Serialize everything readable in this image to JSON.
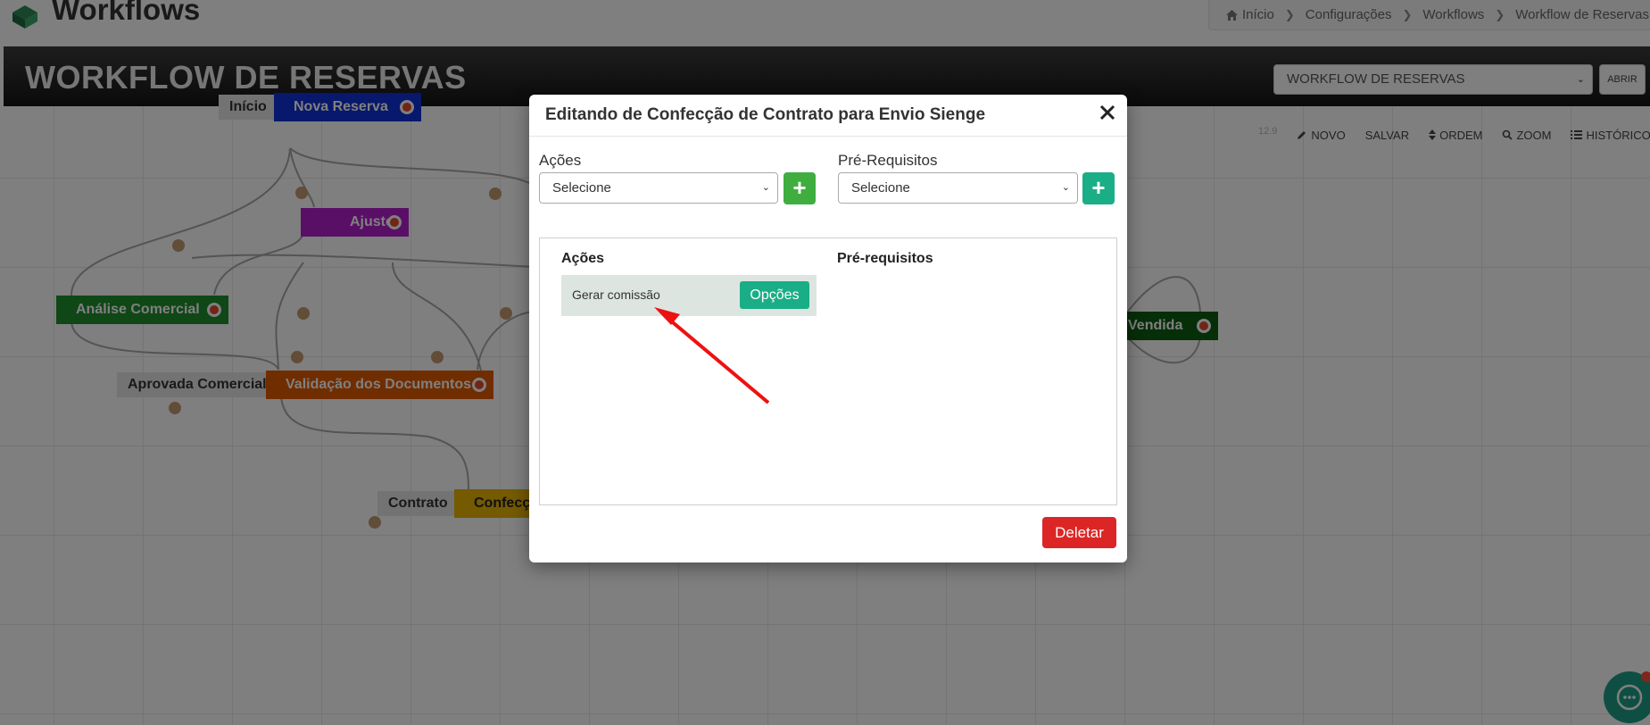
{
  "header": {
    "title": "Workflows",
    "breadcrumb": [
      "Início",
      "Configurações",
      "Workflows",
      "Workflow de Reservas"
    ]
  },
  "banner": {
    "title": "WORKFLOW DE RESERVAS",
    "selected_workflow": "WORKFLOW DE RESERVAS",
    "open_label": "ABRIR"
  },
  "toolbar": {
    "faint_label": "12.9",
    "novo": "NOVO",
    "salvar": "SALVAR",
    "ordem": "ORDEM",
    "zoom": "ZOOM",
    "historico": "HISTÓRICO"
  },
  "workflow": {
    "labels": [
      "Início",
      "Aprovada Comercial",
      "Contrato"
    ],
    "nodes": [
      "Nova Reserva",
      "Ajustes",
      "Análise Comercial",
      "Validação dos Documentos",
      "Confecção de Contrato",
      "Vendida"
    ]
  },
  "colors": {
    "nova_reserva": "#1030d8",
    "ajustes": "#b51fcf",
    "analise_comercial": "#1f8f2f",
    "validacao": "#e05a00",
    "confeccao": "#e8b400",
    "vendida": "#0d5c10",
    "primary_green": "#1aae86",
    "add_green": "#3fae3f",
    "danger": "#dc2626"
  },
  "modal": {
    "title": "Editando de Confecção de Contrato para Envio Sienge",
    "acoes_label": "Ações",
    "acoes_select": "Selecione",
    "prereq_label": "Pré-Requisitos",
    "prereq_select": "Selecione",
    "add_symbol": "+",
    "list": {
      "acoes_header": "Ações",
      "prereq_header": "Pré-requisitos",
      "acoes": [
        {
          "name": "Gerar comissão",
          "options_label": "Opções"
        }
      ]
    },
    "delete_label": "Deletar"
  }
}
